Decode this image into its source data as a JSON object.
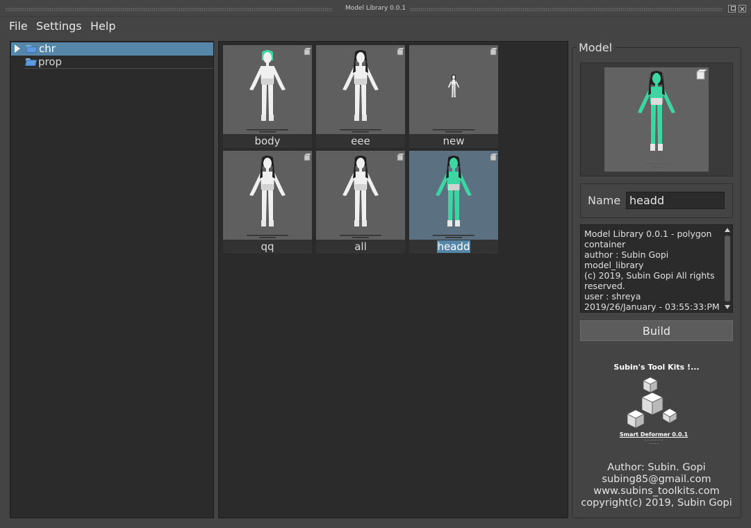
{
  "window": {
    "title": "Model Library 0.0.1"
  },
  "menu": {
    "items": [
      "File",
      "Settings",
      "Help"
    ]
  },
  "tree": {
    "items": [
      {
        "label": "chr",
        "selected": true,
        "expandable": true
      },
      {
        "label": "prop",
        "selected": false,
        "expandable": false
      }
    ]
  },
  "grid": {
    "items": [
      {
        "label": "body",
        "selected": false
      },
      {
        "label": "eee",
        "selected": false
      },
      {
        "label": "new",
        "selected": false
      },
      {
        "label": "qq",
        "selected": false
      },
      {
        "label": "all",
        "selected": false
      },
      {
        "label": "headd",
        "selected": true
      }
    ]
  },
  "model_panel": {
    "title": "Model",
    "name_label": "Name",
    "name_value": "headd",
    "info_lines": [
      "Model Library 0.0.1 - polygon",
      "container",
      "author : Subin Gopi",
      "model_library",
      "(c) 2019, Subin Gopi All rights",
      "reserved.",
      "user : shreya",
      "2019/26/January - 03:55:33:PM"
    ],
    "build_label": "Build"
  },
  "logo": {
    "title": "Subin's Tool Kits !...",
    "subtitle": "Smart Deformer 0.0.1"
  },
  "credits": {
    "author": "Author: Subin. Gopi",
    "email": "subing85@gmail.com",
    "website": "www.subins_toolkits.com",
    "copyright": "copyright(c) 2019, Subin Gopi"
  },
  "colors": {
    "background": "#444444",
    "panel": "#2b2b2b",
    "selection": "#5687a9",
    "thumbnail_bg": "#5f5f5f",
    "selected_thumbnail_bg": "#5b7181",
    "highlight_green": "#3dd6a3"
  }
}
